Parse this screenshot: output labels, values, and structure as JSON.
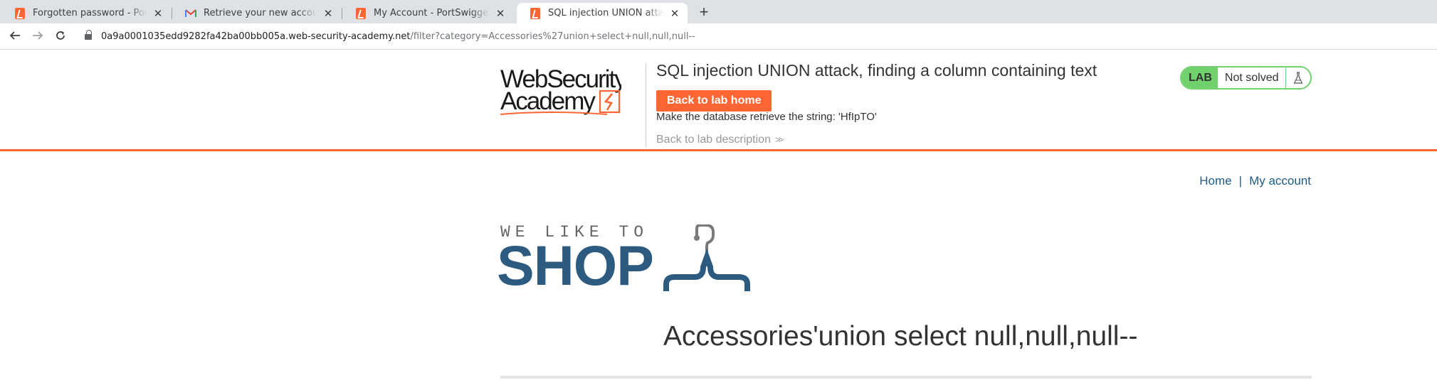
{
  "browser": {
    "tabs": [
      {
        "title": "Forgotten password - PortSwigger",
        "icon": "portswigger-icon",
        "active": false
      },
      {
        "title": "Retrieve your new account details",
        "icon": "gmail-icon",
        "active": false
      },
      {
        "title": "My Account - PortSwigger",
        "icon": "portswigger-icon",
        "active": false
      },
      {
        "title": "SQL injection UNION attack, finding a column containing text",
        "icon": "portswigger-icon",
        "active": true
      }
    ],
    "new_tab": "+",
    "url_host": "0a9a0001035edd9282fa42ba00bb005a.web-security-academy.net",
    "url_path": "/filter?category=Accessories%27union+select+null,null,null--"
  },
  "lab": {
    "logo_line1": "WebSecurity",
    "logo_line2": "Academy",
    "title": "SQL injection UNION attack, finding a column containing text",
    "back_button": "Back to lab home",
    "instruction": "Make the database retrieve the string: 'HfIpTO'",
    "back_description": "Back to lab description",
    "status_label": "LAB",
    "status_text": "Not solved",
    "colors": {
      "accent": "#ff6633",
      "solved_badge": "#70d16d",
      "shop_blue": "#2d5a7f",
      "link": "#1d5c85"
    }
  },
  "nav": {
    "home": "Home",
    "separator": "|",
    "account": "My account"
  },
  "shop": {
    "tagline": "WE LIKE TO",
    "word": "SHOP"
  },
  "category_heading": "Accessories'union select null,null,null--"
}
